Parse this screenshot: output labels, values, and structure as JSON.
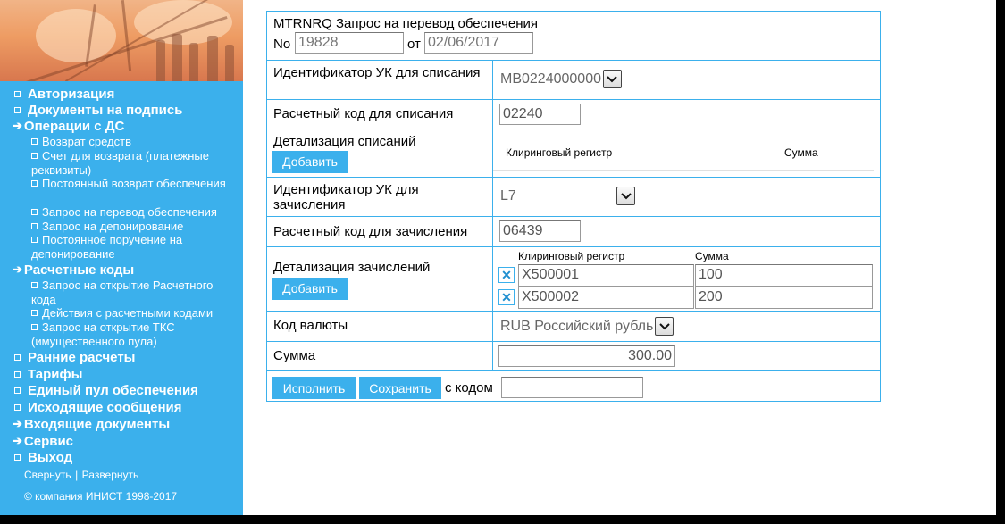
{
  "colors": {
    "accent": "#3bb0ec",
    "sidebar_bg": "#3bb0ec",
    "text": "#000000"
  },
  "sidebar": {
    "nav": [
      {
        "label": "Авторизация",
        "icon": "square-bullet-icon"
      },
      {
        "label": "Документы на подпись",
        "icon": "square-bullet-icon"
      },
      {
        "label": "Операции с ДС",
        "icon": "arrow-right-icon"
      },
      {
        "label": "Расчетные коды",
        "icon": "arrow-right-icon"
      },
      {
        "label": "Ранние расчеты",
        "icon": "square-bullet-icon"
      },
      {
        "label": "Тарифы",
        "icon": "square-bullet-icon"
      },
      {
        "label": "Единый пул обеспечения",
        "icon": "square-bullet-icon"
      },
      {
        "label": "Исходящие сообщения",
        "icon": "square-bullet-icon"
      },
      {
        "label": "Входящие документы",
        "icon": "arrow-right-icon"
      },
      {
        "label": "Сервис",
        "icon": "arrow-right-icon"
      },
      {
        "label": "Выход",
        "icon": "square-bullet-icon"
      }
    ],
    "sub_ds": [
      "Возврат средств",
      "Счет для возврата (платежные реквизиты)",
      "Постоянный возврат обеспечения",
      "Запрос на перевод обеспечения",
      "Запрос на депонирование",
      "Постоянное поручение на депонирование"
    ],
    "sub_codes": [
      "Запрос на открытие Расчетного кода",
      "Действия с расчетными кодами",
      "Запрос на открытие ТКС (имущественного пула)"
    ],
    "collapse": "Свернуть",
    "separator": "|",
    "expand": "Развернуть",
    "copyright": "© компания ИНИСТ 1998-2017"
  },
  "form": {
    "title": "MTRNRQ Запрос на перевод обеспечения",
    "no_label": "No",
    "no_value": "19828",
    "date_label": "от",
    "date_value": "02/06/2017",
    "uk_debit_label": "Идентификатор УК для списания",
    "uk_debit_value": "MB0224000000",
    "code_debit_label": "Расчетный код для списания",
    "code_debit_value": "02240",
    "detail_debit_label": "Детализация списаний",
    "add_label": "Добавить",
    "col_register": "Клиринговый регистр",
    "col_amount": "Сумма",
    "uk_credit_label": "Идентификатор УК для зачисления",
    "uk_credit_value": "L7",
    "code_credit_label": "Расчетный код для зачисления",
    "code_credit_value": "06439",
    "detail_credit_label": "Детализация зачислений",
    "credit_rows": [
      {
        "register": "X500001",
        "amount": "100"
      },
      {
        "register": "X500002",
        "amount": "200"
      }
    ],
    "currency_label": "Код валюты",
    "currency_value": "RUB Российский рубль",
    "sum_label": "Сумма",
    "sum_value": "300.00",
    "execute_label": "Исполнить",
    "save_label": "Сохранить",
    "with_code_label": "с кодом",
    "code_input_value": ""
  }
}
